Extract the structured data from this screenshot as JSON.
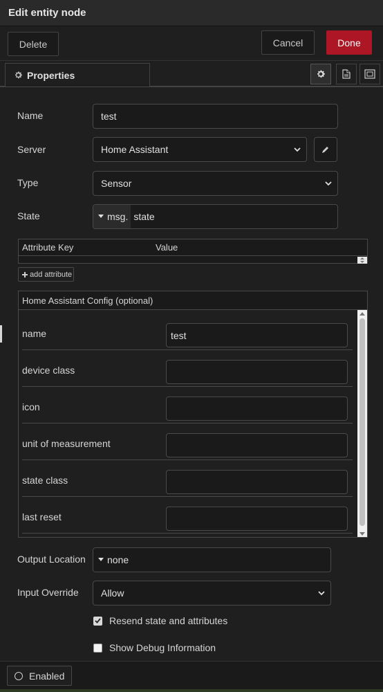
{
  "window": {
    "title": "Edit entity node"
  },
  "toolbar": {
    "delete_label": "Delete",
    "cancel_label": "Cancel",
    "done_label": "Done"
  },
  "tabs": {
    "properties_label": "Properties",
    "icons": [
      "gear-icon",
      "description-icon",
      "appearance-icon"
    ]
  },
  "form": {
    "name": {
      "label": "Name",
      "value": "test"
    },
    "server": {
      "label": "Server",
      "value": "Home Assistant"
    },
    "type": {
      "label": "Type",
      "value": "Sensor"
    },
    "state": {
      "label": "State",
      "type_prefix": "msg.",
      "value": "state"
    },
    "attributes": {
      "key_header": "Attribute Key",
      "value_header": "Value",
      "add_label": "add attribute"
    },
    "ha_config": {
      "title": "Home Assistant Config (optional)",
      "rows": [
        {
          "label": "name",
          "value": "test"
        },
        {
          "label": "device class",
          "value": ""
        },
        {
          "label": "icon",
          "value": ""
        },
        {
          "label": "unit of measurement",
          "value": ""
        },
        {
          "label": "state class",
          "value": ""
        },
        {
          "label": "last reset",
          "value": ""
        }
      ]
    },
    "output_location": {
      "label": "Output Location",
      "value": "none"
    },
    "input_override": {
      "label": "Input Override",
      "value": "Allow"
    },
    "resend": {
      "label": "Resend state and attributes",
      "checked": true
    },
    "debug": {
      "label": "Show Debug Information",
      "checked": false
    }
  },
  "footer": {
    "enabled_label": "Enabled"
  },
  "colors": {
    "accent_done": "#ad1625",
    "background": "#1f1f1f",
    "border": "#4a4a4a"
  }
}
